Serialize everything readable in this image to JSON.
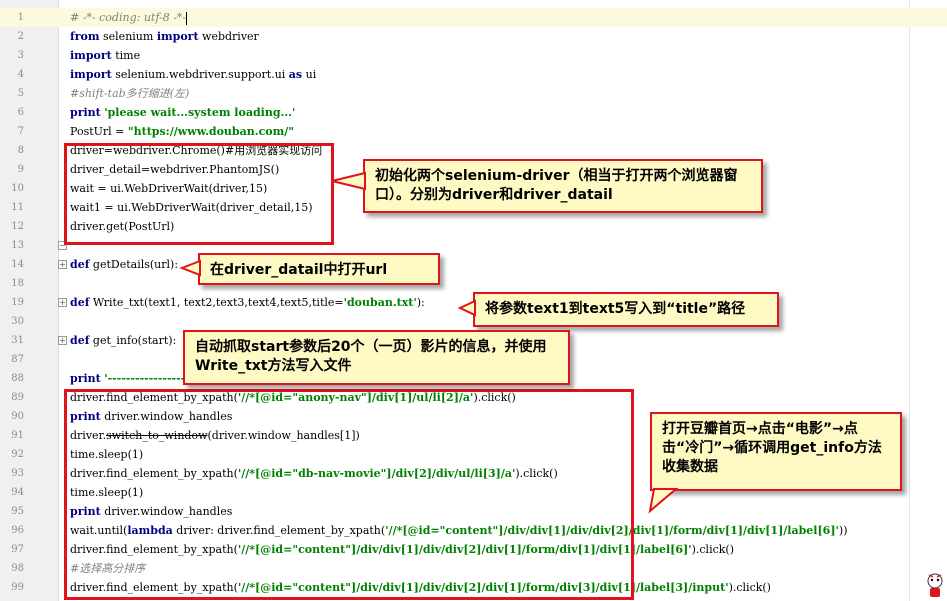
{
  "editor": {
    "lines": [
      {
        "n": "1",
        "parts": [
          [
            "cmt",
            "# -*- coding: utf-8 -*-"
          ]
        ]
      },
      {
        "n": "2",
        "parts": [
          [
            "kw",
            "from"
          ],
          [
            "p",
            " selenium "
          ],
          [
            "kw",
            "import"
          ],
          [
            "p",
            " webdriver"
          ]
        ]
      },
      {
        "n": "3",
        "parts": [
          [
            "kw",
            "import"
          ],
          [
            "p",
            " time"
          ]
        ]
      },
      {
        "n": "4",
        "parts": [
          [
            "kw",
            "import"
          ],
          [
            "p",
            " selenium.webdriver.support.ui "
          ],
          [
            "kw",
            "as"
          ],
          [
            "p",
            " ui"
          ]
        ]
      },
      {
        "n": "5",
        "parts": [
          [
            "cmt",
            "#shift-tab多行缩进(左)"
          ]
        ]
      },
      {
        "n": "6",
        "parts": [
          [
            "kw",
            "print"
          ],
          [
            "p",
            " "
          ],
          [
            "str",
            "'please wait...system loading...'"
          ]
        ]
      },
      {
        "n": "7",
        "parts": [
          [
            "p",
            "PostUrl = "
          ],
          [
            "str",
            "\"https://www.douban.com/\""
          ]
        ]
      },
      {
        "n": "8",
        "parts": [
          [
            "p",
            "driver=webdriver.Chrome()#用浏览器实现访问"
          ]
        ]
      },
      {
        "n": "9",
        "parts": [
          [
            "p",
            "driver_detail=webdriver.PhantomJS()"
          ]
        ]
      },
      {
        "n": "10",
        "parts": [
          [
            "p",
            "wait = ui.WebDriverWait(driver,15)"
          ]
        ]
      },
      {
        "n": "11",
        "parts": [
          [
            "p",
            "wait1 = ui.WebDriverWait(driver_detail,15)"
          ]
        ]
      },
      {
        "n": "12",
        "parts": [
          [
            "p",
            "driver.get(PostUrl)"
          ]
        ]
      },
      {
        "n": "13",
        "parts": []
      },
      {
        "n": "14",
        "parts": [
          [
            "kw",
            "def"
          ],
          [
            "p",
            " getDetails(url):"
          ]
        ]
      },
      {
        "n": "18",
        "parts": []
      },
      {
        "n": "19",
        "parts": [
          [
            "kw",
            "def"
          ],
          [
            "p",
            " Write_txt(text1, text2,text3,text4,text5,title="
          ],
          [
            "str",
            "'douban.txt'"
          ],
          [
            "p",
            "):"
          ]
        ]
      },
      {
        "n": "30",
        "parts": []
      },
      {
        "n": "31",
        "parts": [
          [
            "kw",
            "def"
          ],
          [
            "p",
            " get_info(start):"
          ]
        ]
      },
      {
        "n": "87",
        "parts": []
      },
      {
        "n": "88",
        "parts": [
          [
            "kw",
            "print"
          ],
          [
            "p",
            " "
          ],
          [
            "str",
            "'------------------------'"
          ]
        ]
      },
      {
        "n": "89",
        "parts": [
          [
            "p",
            "driver.find_element_by_xpath("
          ],
          [
            "str",
            "'//*[@id=\"anony-nav\"]/div[1]/ul/li[2]/a'"
          ],
          [
            "p",
            ").click()"
          ]
        ]
      },
      {
        "n": "90",
        "parts": [
          [
            "kw",
            "print"
          ],
          [
            "p",
            " driver.window_handles"
          ]
        ]
      },
      {
        "n": "91",
        "parts": [
          [
            "p",
            "driver."
          ],
          [
            "s",
            "switch_to_window"
          ],
          [
            "p",
            "(driver.window_handles[1])"
          ]
        ]
      },
      {
        "n": "92",
        "parts": [
          [
            "p",
            "time.sleep(1)"
          ]
        ]
      },
      {
        "n": "93",
        "parts": [
          [
            "p",
            "driver.find_element_by_xpath("
          ],
          [
            "str",
            "'//*[@id=\"db-nav-movie\"]/div[2]/div/ul/li[3]/a'"
          ],
          [
            "p",
            ").click()"
          ]
        ]
      },
      {
        "n": "94",
        "parts": [
          [
            "p",
            "time.sleep(1)"
          ]
        ]
      },
      {
        "n": "95",
        "parts": [
          [
            "kw",
            "print"
          ],
          [
            "p",
            " driver.window_handles"
          ]
        ]
      },
      {
        "n": "96",
        "parts": [
          [
            "p",
            "wait.until("
          ],
          [
            "kw",
            "lambda"
          ],
          [
            "p",
            " driver: driver.find_element_by_xpath("
          ],
          [
            "str",
            "'//*[@id=\"content\"]/div/div[1]/div/div[2]/div[1]/form/div[1]/div[1]/label[6]'"
          ],
          [
            "p",
            "))"
          ]
        ]
      },
      {
        "n": "97",
        "parts": [
          [
            "p",
            "driver.find_element_by_xpath("
          ],
          [
            "str",
            "'//*[@id=\"content\"]/div/div[1]/div/div[2]/div[1]/form/div[1]/div[1]/label[6]'"
          ],
          [
            "p",
            ").click()"
          ]
        ]
      },
      {
        "n": "98",
        "parts": [
          [
            "cmt",
            "#选择高分排序"
          ]
        ]
      },
      {
        "n": "99",
        "parts": [
          [
            "p",
            "driver.find_element_by_xpath("
          ],
          [
            "str",
            "'//*[@id=\"content\"]/div/div[1]/div/div[2]/div[1]/form/div[3]/div[1]/label[3]/input'"
          ],
          [
            "p",
            ").click()"
          ]
        ]
      }
    ]
  },
  "annotations": {
    "init_drivers": "初始化两个selenium-driver（相当于打开两个浏览器窗口）。分别为driver和driver_datail",
    "open_url": "在driver_datail中打开url",
    "write_params": "将参数text1到text5写入到“title”路径",
    "auto_fetch": "自动抓取start参数后20个（一页）影片的信息，并使用Write_txt方法写入文件",
    "douban_flow": "打开豆瓣首页→点击“电影”→点击“冷门”→循环调用get_info方法收集数据"
  },
  "colors": {
    "keyword": "#000080",
    "string": "#008000",
    "comment": "#808080",
    "highlight_border": "#e0121b",
    "callout_bg": "#fff9c4"
  }
}
